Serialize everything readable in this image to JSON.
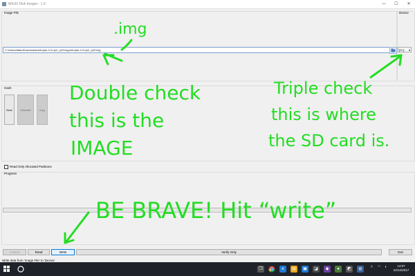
{
  "window": {
    "title": "Win32 Disk Imager - 1.0",
    "min_glyph": "—",
    "max_glyph": "☐",
    "close_glyph": "✕"
  },
  "image_file": {
    "label": "Image File",
    "path": "C:/Users/tatan/Downloads/retropie-4.3-rpi2_rpi3.img/retropie-4.3-rpi2_rpi3.img"
  },
  "device": {
    "label": "Device",
    "value": "[D:\\]",
    "arrow": "▾"
  },
  "hash": {
    "label": "Hash",
    "selected": "None",
    "generate_label": "Generate",
    "copy_label": "Copy"
  },
  "options": {
    "read_only_allocated_label": "Read Only Allocated Partitions",
    "read_only_allocated_checked": false
  },
  "progress": {
    "label": "Progress",
    "value": 0
  },
  "buttons": {
    "cancel": "Cancel",
    "read": "Read",
    "write": "Write",
    "verify": "Verify Only",
    "exit": "Exit"
  },
  "status": {
    "text": "Write data from 'Image File' to 'Device'"
  },
  "taskbar": {
    "clock_time": "14:07",
    "clock_date": "22/12/2017"
  },
  "annotations": {
    "img": ".img",
    "double_check_1": "Double check",
    "double_check_2": "this is the",
    "double_check_3": "IMAGE",
    "triple_check_1": "Triple check",
    "triple_check_2": "this is where",
    "triple_check_3": "the SD card is.",
    "be_brave": "BE BRAVE! Hit “write”",
    "color": "#22dd22"
  },
  "colors": {
    "focus_accent": "#0078d7",
    "taskbar_bg": "#1f2229"
  }
}
